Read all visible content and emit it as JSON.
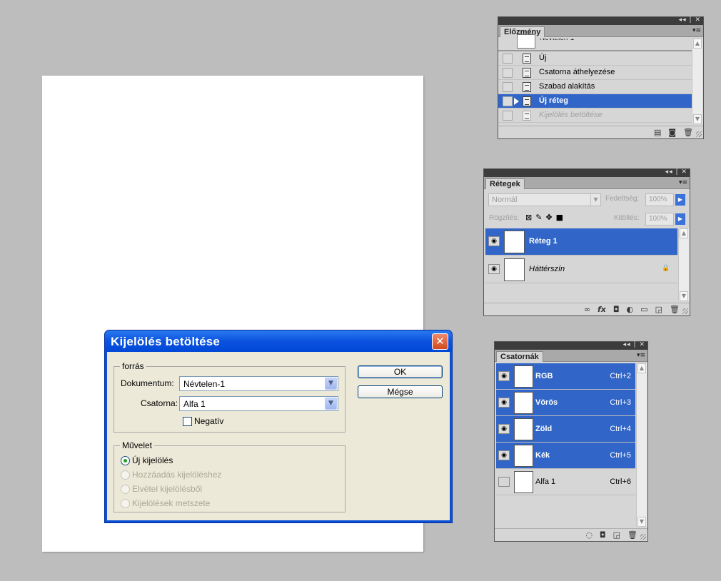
{
  "history_panel": {
    "tab": "Előzmény",
    "snapshot_label": "Névtelen-1",
    "items": [
      {
        "label": "Új",
        "state": "normal"
      },
      {
        "label": "Csatorna áthelyezése",
        "state": "normal"
      },
      {
        "label": "Szabad alakítás",
        "state": "normal"
      },
      {
        "label": "Új réteg",
        "state": "selected"
      },
      {
        "label": "Kijelölés betöltése",
        "state": "dimmed"
      }
    ]
  },
  "layers_panel": {
    "tab": "Rétegek",
    "blend_mode": "Normál",
    "opacity_label": "Fedettség:",
    "opacity_value": "100%",
    "lock_label": "Rögzítés:",
    "fill_label": "Kitöltés:",
    "fill_value": "100%",
    "layers": [
      {
        "name": "Réteg 1",
        "selected": true
      },
      {
        "name": "Háttérszín",
        "selected": false
      }
    ]
  },
  "channels_panel": {
    "tab": "Csatornák",
    "channels": [
      {
        "name": "RGB",
        "shortcut": "Ctrl+2",
        "selected": true
      },
      {
        "name": "Vörös",
        "shortcut": "Ctrl+3",
        "selected": true
      },
      {
        "name": "Zöld",
        "shortcut": "Ctrl+4",
        "selected": true
      },
      {
        "name": "Kék",
        "shortcut": "Ctrl+5",
        "selected": true
      },
      {
        "name": "Alfa 1",
        "shortcut": "Ctrl+6",
        "selected": false
      }
    ]
  },
  "dialog": {
    "title": "Kijelölés betöltése",
    "source_group": "forrás",
    "document_label": "Dokumentum:",
    "document_value": "Névtelen-1",
    "channel_label": "Csatorna:",
    "channel_value": "Alfa 1",
    "invert_label": "Negatív",
    "operation_group": "Művelet",
    "operations": [
      {
        "label": "Új kijelölés",
        "selected": true,
        "enabled": true
      },
      {
        "label": "Hozzáadás kijelöléshez",
        "selected": false,
        "enabled": false
      },
      {
        "label": "Elvétel kijelölésből",
        "selected": false,
        "enabled": false
      },
      {
        "label": "Kijelölések metszete",
        "selected": false,
        "enabled": false
      }
    ],
    "ok_label": "OK",
    "cancel_label": "Mégse"
  },
  "colors": {
    "selection_blue": "#3166c8",
    "xp_title_blue": "#0a52df",
    "panel_gray": "#d6d6d6",
    "workspace_gray": "#bdbdbd"
  }
}
